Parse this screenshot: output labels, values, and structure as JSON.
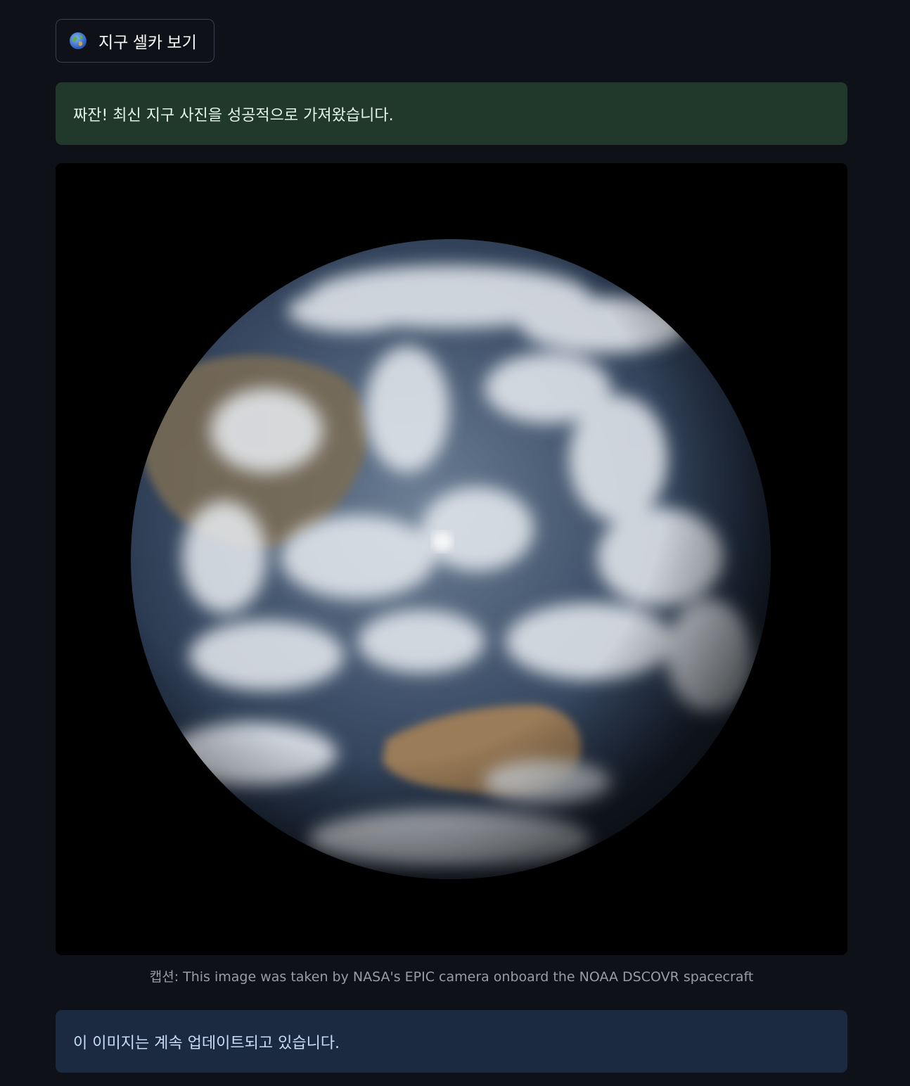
{
  "button": {
    "icon": "globe-icon",
    "label": "지구 셀카 보기"
  },
  "success_message": "짜잔! 최신 지구 사진을 성공적으로 가져왔습니다.",
  "image": {
    "caption": "캡션: This image was taken by NASA's EPIC camera onboard the NOAA DSCOVR spacecraft"
  },
  "info_message": "이 이미지는 계속 업데이트되고 있습니다.",
  "colors": {
    "background": "#0e1117",
    "success_bg": "#21392a",
    "info_bg": "#1b2a41"
  }
}
